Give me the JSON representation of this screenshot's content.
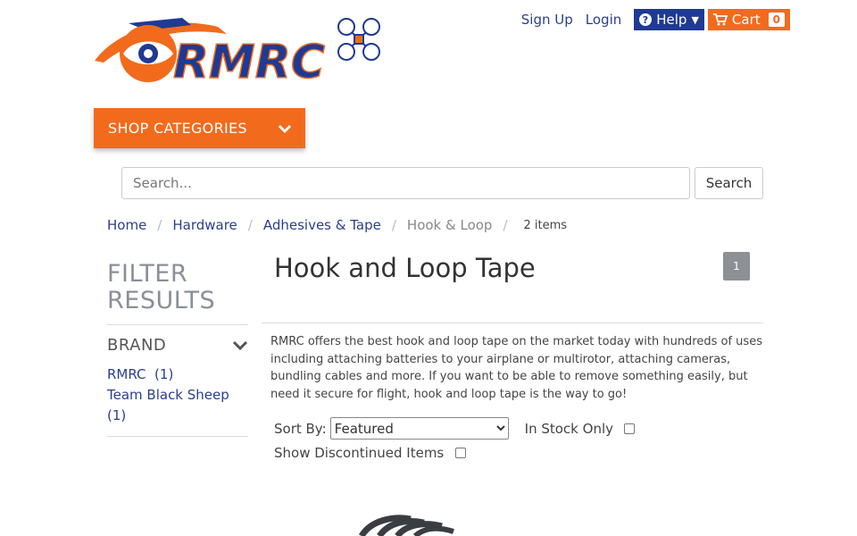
{
  "header": {
    "logo_text": "RMRC",
    "sign_up": "Sign Up",
    "login": "Login",
    "help": "Help",
    "cart": "Cart",
    "cart_count": "0"
  },
  "shop_categories": "SHOP CATEGORIES",
  "search": {
    "placeholder": "Search...",
    "button": "Search"
  },
  "breadcrumb": {
    "items": [
      "Home",
      "Hardware",
      "Adhesives & Tape"
    ],
    "current": "Hook & Loop",
    "count": "2 items"
  },
  "sidebar": {
    "title": "FILTER RESULTS",
    "brand_heading": "BRAND",
    "brands": [
      "RMRC  (1)",
      "Team Black Sheep (1)"
    ]
  },
  "main": {
    "title": "Hook and Loop Tape",
    "page_badge": "1",
    "description": "RMRC offers the best hook and loop tape on the market today with hundreds of uses including attaching batteries to your airplane or multirotor, attaching cameras, bundling cables and more. If you want to be able to remove something easily, but need it secure for flight, hook and loop tape is the way to go!",
    "sort_label": "Sort By:",
    "sort_value": "Featured",
    "in_stock_label": "In Stock Only",
    "discontinued_label": "Show Discontinued Items"
  },
  "colors": {
    "brand_orange": "#f26b1d",
    "brand_blue": "#1f3a93",
    "link_blue": "#2a3f8c"
  }
}
